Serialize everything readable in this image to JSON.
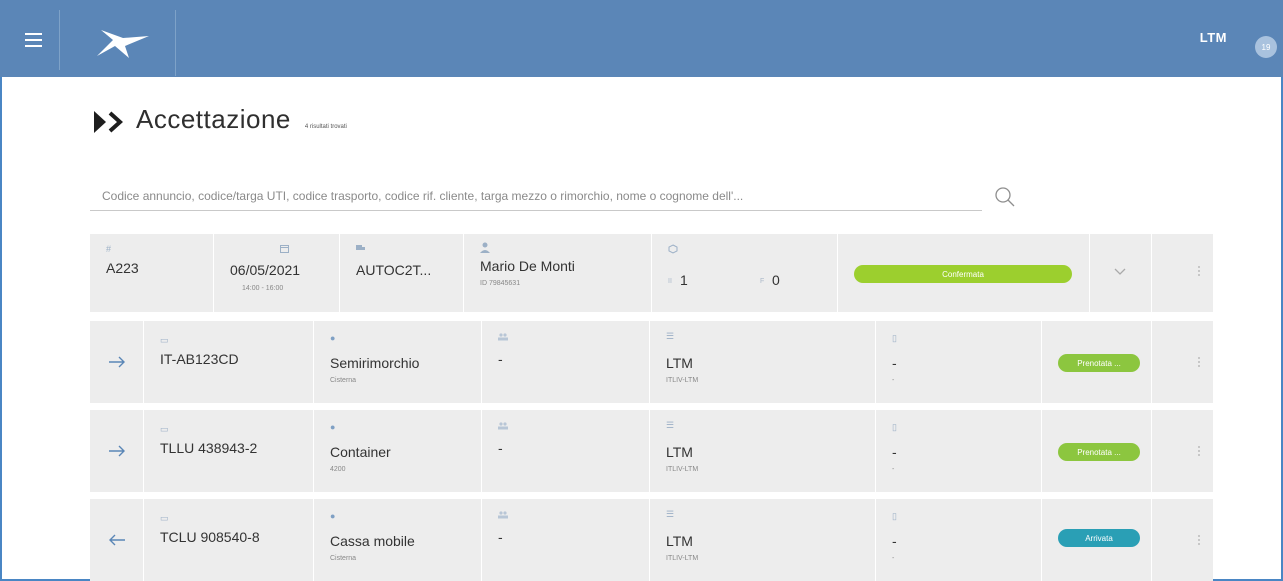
{
  "header": {
    "brand": "LTM",
    "avatar_initials": "19",
    "bar_color": "#5b86b7"
  },
  "page": {
    "title": "Accettazione",
    "results_note": "4 risultati trovati"
  },
  "search": {
    "placeholder": "Codice annuncio, codice/targa UTI, codice trasporto, codice rif. cliente, targa mezzo o rimorchio, nome o cognome dell'..."
  },
  "summary": {
    "code": "A223",
    "date": "06/05/2021",
    "time": "14:00 - 16:00",
    "vehicle": "AUTOC2T...",
    "driver": "Mario De Monti",
    "driver_id": "ID 79845631",
    "count_a_label": "II",
    "count_a": "1",
    "count_b_label": "F",
    "count_b": "0",
    "status": "Confermata",
    "status_color": "#9ccf2e"
  },
  "rows": [
    {
      "direction": "in",
      "uti": "IT-AB123CD",
      "type": "Semirimorchio",
      "subtype": "Cisterna",
      "person": "-",
      "company": "LTM",
      "company_code": "ITLIV-LTM",
      "extra": "-",
      "extra_sub": "-",
      "status": "Prenotata ...",
      "status_color": "#8cc63f"
    },
    {
      "direction": "in",
      "uti": "TLLU 438943-2",
      "type": "Container",
      "subtype": "4200",
      "person": "-",
      "company": "LTM",
      "company_code": "ITLIV-LTM",
      "extra": "-",
      "extra_sub": "-",
      "status": "Prenotata ...",
      "status_color": "#8cc63f"
    },
    {
      "direction": "out",
      "uti": "TCLU 908540-8",
      "type": "Cassa mobile",
      "subtype": "Cisterna",
      "person": "-",
      "company": "LTM",
      "company_code": "ITLIV-LTM",
      "extra": "-",
      "extra_sub": "-",
      "status": "Arrivata",
      "status_color": "#2a9fb5"
    }
  ]
}
